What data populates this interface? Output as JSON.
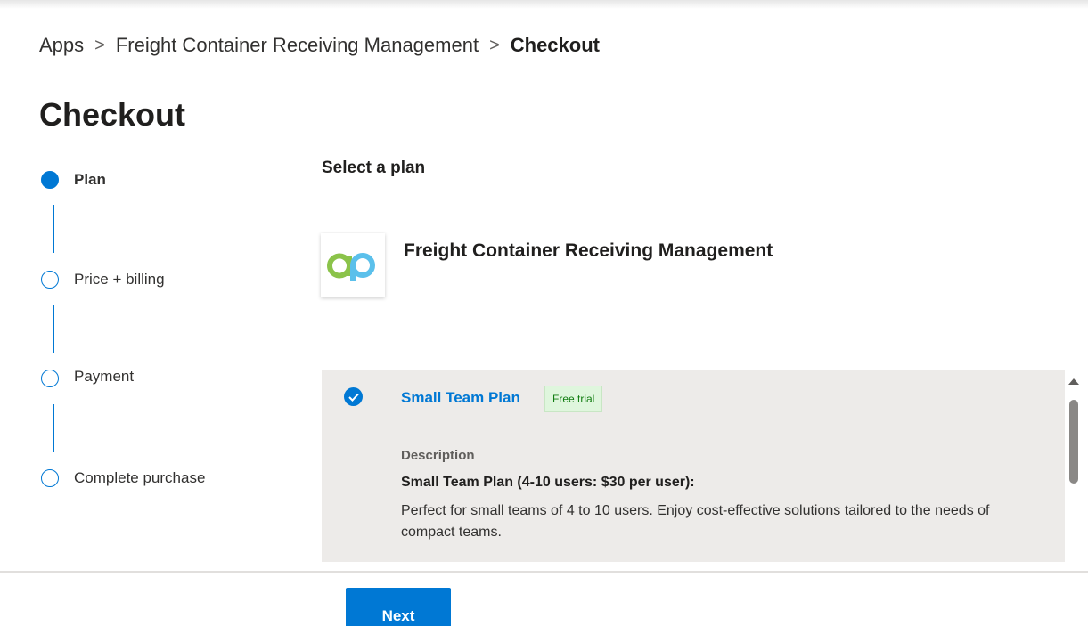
{
  "breadcrumb": {
    "items": [
      "Apps",
      "Freight Container Receiving Management"
    ],
    "separator": ">",
    "current": "Checkout"
  },
  "page_title": "Checkout",
  "steps": [
    {
      "label": "Plan",
      "state": "active"
    },
    {
      "label": "Price + billing",
      "state": "pending"
    },
    {
      "label": "Payment",
      "state": "pending"
    },
    {
      "label": "Complete purchase",
      "state": "pending"
    }
  ],
  "main": {
    "section_title": "Select a plan",
    "app_name": "Freight Container Receiving Management",
    "plan": {
      "name": "Small Team Plan",
      "badge": "Free trial",
      "selected": true,
      "description_label": "Description",
      "description_title": "Small Team Plan (4-10 users: $30 per user):",
      "description_text": "Perfect for small teams of 4 to 10 users. Enjoy cost-effective solutions tailored to the needs of compact teams."
    }
  },
  "footer": {
    "next_label": "Next"
  },
  "colors": {
    "accent": "#0078d4",
    "card_bg": "#edebe9",
    "badge_bg": "#dff6dd",
    "badge_text": "#107c10",
    "logo_green": "#8bc34a",
    "logo_blue": "#5bc0eb"
  },
  "icons": {
    "app_logo": "app-logo-icon",
    "plan_selected": "checkmark-circle-icon",
    "scroll_up": "caret-up-icon"
  }
}
